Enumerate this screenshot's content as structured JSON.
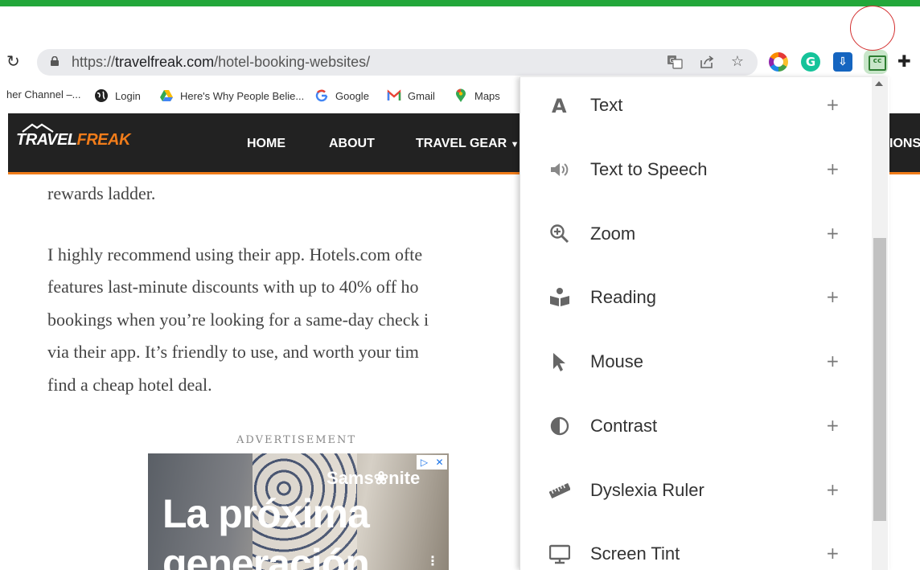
{
  "browser": {
    "url_scheme": "https://",
    "url_host": "travelfreak.com",
    "url_path": "/hotel-booking-websites/",
    "extensions": [
      "color-wheel-icon",
      "grammarly-icon",
      "save-icon",
      "captions-icon",
      "puzzle-icon"
    ]
  },
  "bookmarks": [
    {
      "label": "her Channel –...",
      "icon": "channel-icon"
    },
    {
      "label": "Login",
      "icon": "globe-icon"
    },
    {
      "label": "Here's Why People Belie...",
      "icon": "google-drive-icon"
    },
    {
      "label": "Google",
      "icon": "google-icon"
    },
    {
      "label": "Gmail",
      "icon": "gmail-icon"
    },
    {
      "label": "Maps",
      "icon": "maps-icon"
    }
  ],
  "site": {
    "logo_travel": "TRAVEL",
    "logo_freak": "FREAK",
    "nav": {
      "home": "HOME",
      "about": "ABOUT",
      "travel_gear": "TRAVEL GEAR",
      "cut": "IONS"
    },
    "accent": "#f07c1a"
  },
  "article": {
    "line0": "rewards ladder.",
    "line1": "I highly recommend using their app. Hotels.com ofte",
    "line2": "features last-minute discounts with up to 40% off ho",
    "line3": "bookings when you’re looking for a same-day check i",
    "line4": "via their app. It’s friendly to use, and worth your tim",
    "line5": "find a cheap hotel deal."
  },
  "ad": {
    "label": "ADVERTISEMENT",
    "brand": "Sams❀nite",
    "headline1": "La próxima",
    "headline2": "generación",
    "play": "▷",
    "close": "✕",
    "more": "⋮"
  },
  "panel": {
    "items": [
      {
        "label": "Text",
        "icon": "text-icon",
        "action": "+"
      },
      {
        "label": "Text to Speech",
        "icon": "speaker-icon",
        "action": "+"
      },
      {
        "label": "Zoom",
        "icon": "zoom-in-icon",
        "action": "+"
      },
      {
        "label": "Reading",
        "icon": "reading-icon",
        "action": "+"
      },
      {
        "label": "Mouse",
        "icon": "cursor-icon",
        "action": "+"
      },
      {
        "label": "Contrast",
        "icon": "contrast-icon",
        "action": "+"
      },
      {
        "label": "Dyslexia Ruler",
        "icon": "ruler-icon",
        "action": "+"
      },
      {
        "label": "Screen Tint",
        "icon": "monitor-icon",
        "action": "+"
      }
    ]
  }
}
